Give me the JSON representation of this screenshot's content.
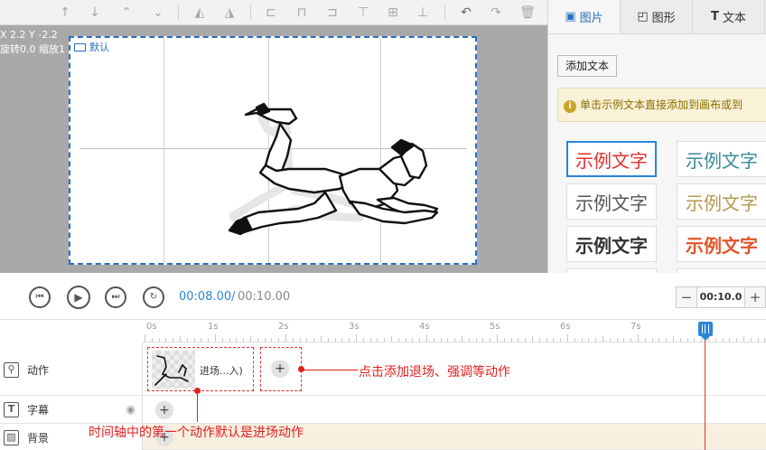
{
  "toolbar": {
    "buttons": [
      "move-up-icon",
      "move-down-icon",
      "move-top-icon",
      "move-bottom-icon",
      "flip-horizontal-icon",
      "flip-vertical-icon",
      "align-left-icon",
      "align-center-icon",
      "align-right-icon",
      "align-top-icon",
      "align-middle-icon",
      "align-bottom-icon",
      "undo-icon",
      "redo-icon",
      "delete-icon"
    ]
  },
  "canvas": {
    "coords": "X 2.2 Y -2.2",
    "transform": "旋转0.0 缩放1",
    "stage_label": "默认"
  },
  "panel": {
    "tabs": [
      {
        "label": "图片",
        "icon": "image-icon",
        "active": true
      },
      {
        "label": "图形",
        "icon": "shape-icon",
        "active": false
      },
      {
        "label": "文本",
        "icon": "text-icon",
        "active": false
      }
    ],
    "add_text": "添加文本",
    "tip": "单击示例文本直接添加到画布或到",
    "samples": [
      {
        "text": "示例文字",
        "color": "#e03030"
      },
      {
        "text": "示例文字",
        "color": "#3a8a9a"
      },
      {
        "text": "示例文字",
        "color": "#555555"
      },
      {
        "text": "示例文字",
        "color": "#b49a50"
      },
      {
        "text": "示例文字",
        "color": "#333333"
      },
      {
        "text": "示例文字",
        "color": "#e0552b"
      }
    ]
  },
  "playback": {
    "current": "00:08.00/",
    "total": " 00:10.00",
    "zoom_value": "00:10.0",
    "zoom_minus": "−",
    "zoom_plus": "+"
  },
  "timeline": {
    "ticks": [
      "0s",
      "1s",
      "2s",
      "3s",
      "4s",
      "5s",
      "6s",
      "7s"
    ],
    "tracks": [
      {
        "label": "动作",
        "icon": "action-icon"
      },
      {
        "label": "字幕",
        "icon": "subtitle-icon"
      },
      {
        "label": "背景",
        "icon": "background-icon"
      }
    ],
    "clip_label": "进场...入)",
    "annotation_add": "点击添加退场、强调等动作",
    "annotation_first": "时间轴中的第一个动作默认是进场动作"
  },
  "colors": {
    "accent": "#2a86d6",
    "annotation": "#e02020",
    "stage_border": "#2a6fbf"
  }
}
